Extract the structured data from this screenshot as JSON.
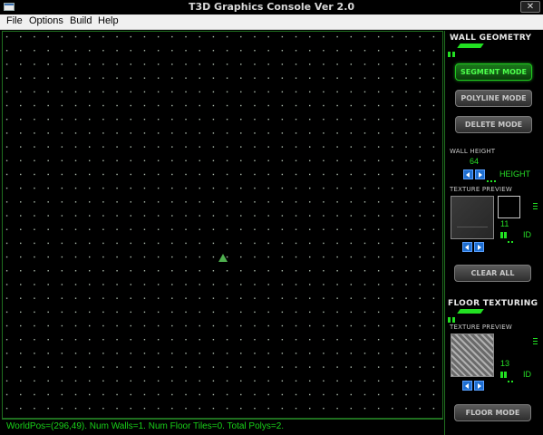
{
  "window": {
    "title": "T3D Graphics Console Ver 2.0",
    "close_glyph": "✕",
    "close_label": "Close"
  },
  "menu": {
    "items": [
      {
        "label": "File"
      },
      {
        "label": "Options"
      },
      {
        "label": "Build"
      },
      {
        "label": "Help"
      }
    ]
  },
  "status": {
    "text": "WorldPos=(296,49). Num Walls=1. Num Floor Tiles=0. Total Polys=2."
  },
  "wall": {
    "title": "WALL GEOMETRY",
    "segment_button": "SEGMENT MODE",
    "polyline_button": "POLYLINE MODE",
    "delete_button": "DELETE MODE",
    "height_label": "WALL HEIGHT",
    "height_value": "64",
    "height_caption": "HEIGHT",
    "texture_label": "TEXTURE PREVIEW",
    "texture_id": "11",
    "id_caption": "ID",
    "clear_button": "CLEAR ALL"
  },
  "floor": {
    "title": "FLOOR TEXTURING",
    "texture_label": "TEXTURE PREVIEW",
    "texture_id": "13",
    "id_caption": "ID",
    "floor_button": "FLOOR MODE"
  },
  "colors": {
    "accent": "#22e022",
    "status_text": "#19d119",
    "arrow_blue": "#1e6ed0"
  }
}
